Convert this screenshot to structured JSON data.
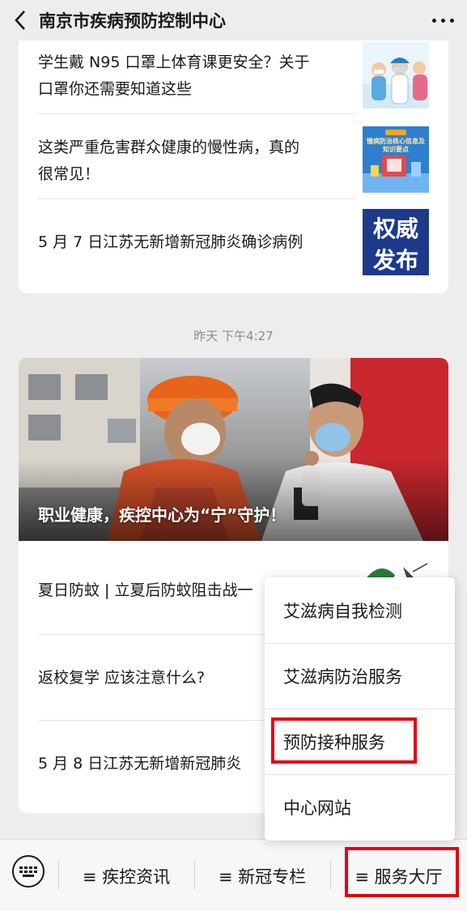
{
  "header": {
    "title": "南京市疾病预防控制中心"
  },
  "card1": {
    "articles": [
      {
        "title_line1": "学生戴 N95 口罩上体育课更安全？关于",
        "title_line2": "口罩你还需要知道这些"
      },
      {
        "title_line1": "这类严重危害群众健康的慢性病，真的",
        "title_line2": "很常见！",
        "thumb_badge": "慢病防治核心信息及知识要点"
      },
      {
        "title_line1": "5 月 7 日江苏无新增新冠肺炎确诊病例",
        "thumb_text_1": "权威",
        "thumb_text_2": "发布"
      }
    ]
  },
  "timestamp": "昨天 下午4:27",
  "card2": {
    "hero_caption": "职业健康，疾控中心为“宁”守护！",
    "articles": [
      {
        "title": "夏日防蚊 | 立夏后防蚊阻击战一"
      },
      {
        "title": "返校复学  应该注意什么?"
      },
      {
        "title": "5 月 8 日江苏无新增新冠肺炎"
      }
    ]
  },
  "popup_menu": {
    "items": [
      "艾滋病自我检测",
      "艾滋病防治服务",
      "预防接种服务",
      "中心网站"
    ]
  },
  "bottom_menu": {
    "items": [
      "≡ 疾控资讯",
      "≡ 新冠专栏",
      "≡ 服务大厅"
    ]
  },
  "colors": {
    "highlight": "#e60012",
    "background": "#ededed"
  }
}
